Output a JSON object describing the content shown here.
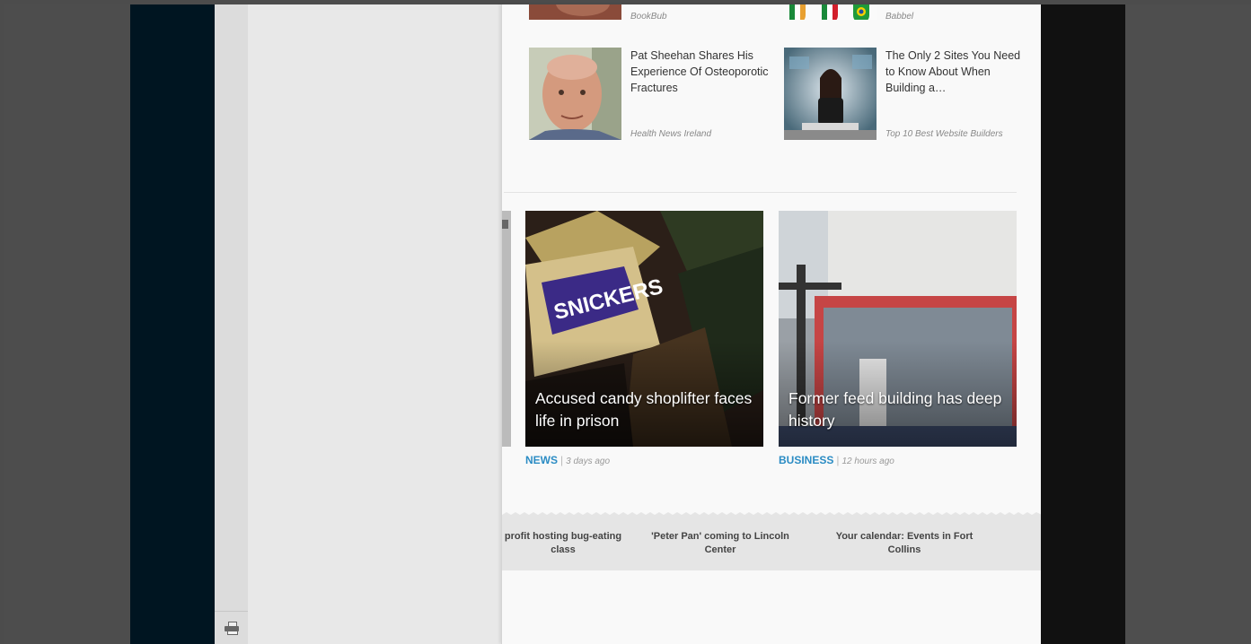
{
  "sponsored": [
    {
      "title": "",
      "source": "BookBub"
    },
    {
      "title": "",
      "source": "Babbel"
    },
    {
      "title": "Pat Sheehan Shares His Experience Of Osteoporotic Fractures",
      "source": "Health News Ireland"
    },
    {
      "title": "The Only 2 Sites You Need to Know About When Building a…",
      "source": "Top 10 Best Website Builders"
    }
  ],
  "stories": [
    {
      "caption": "Accused candy shoplifter faces life in prison",
      "category": "NEWS",
      "time": "3 days ago"
    },
    {
      "caption": "Former feed building has deep history",
      "category": "BUSINESS",
      "time": "12 hours ago"
    }
  ],
  "related": [
    "profit hosting bug-eating class",
    "'Peter Pan' coming to Lincoln Center",
    "Your calendar: Events in Fort Collins"
  ],
  "colors": {
    "accent": "#2b8cc4",
    "navy": "#001521"
  },
  "icons": {
    "print": "printer-icon"
  }
}
